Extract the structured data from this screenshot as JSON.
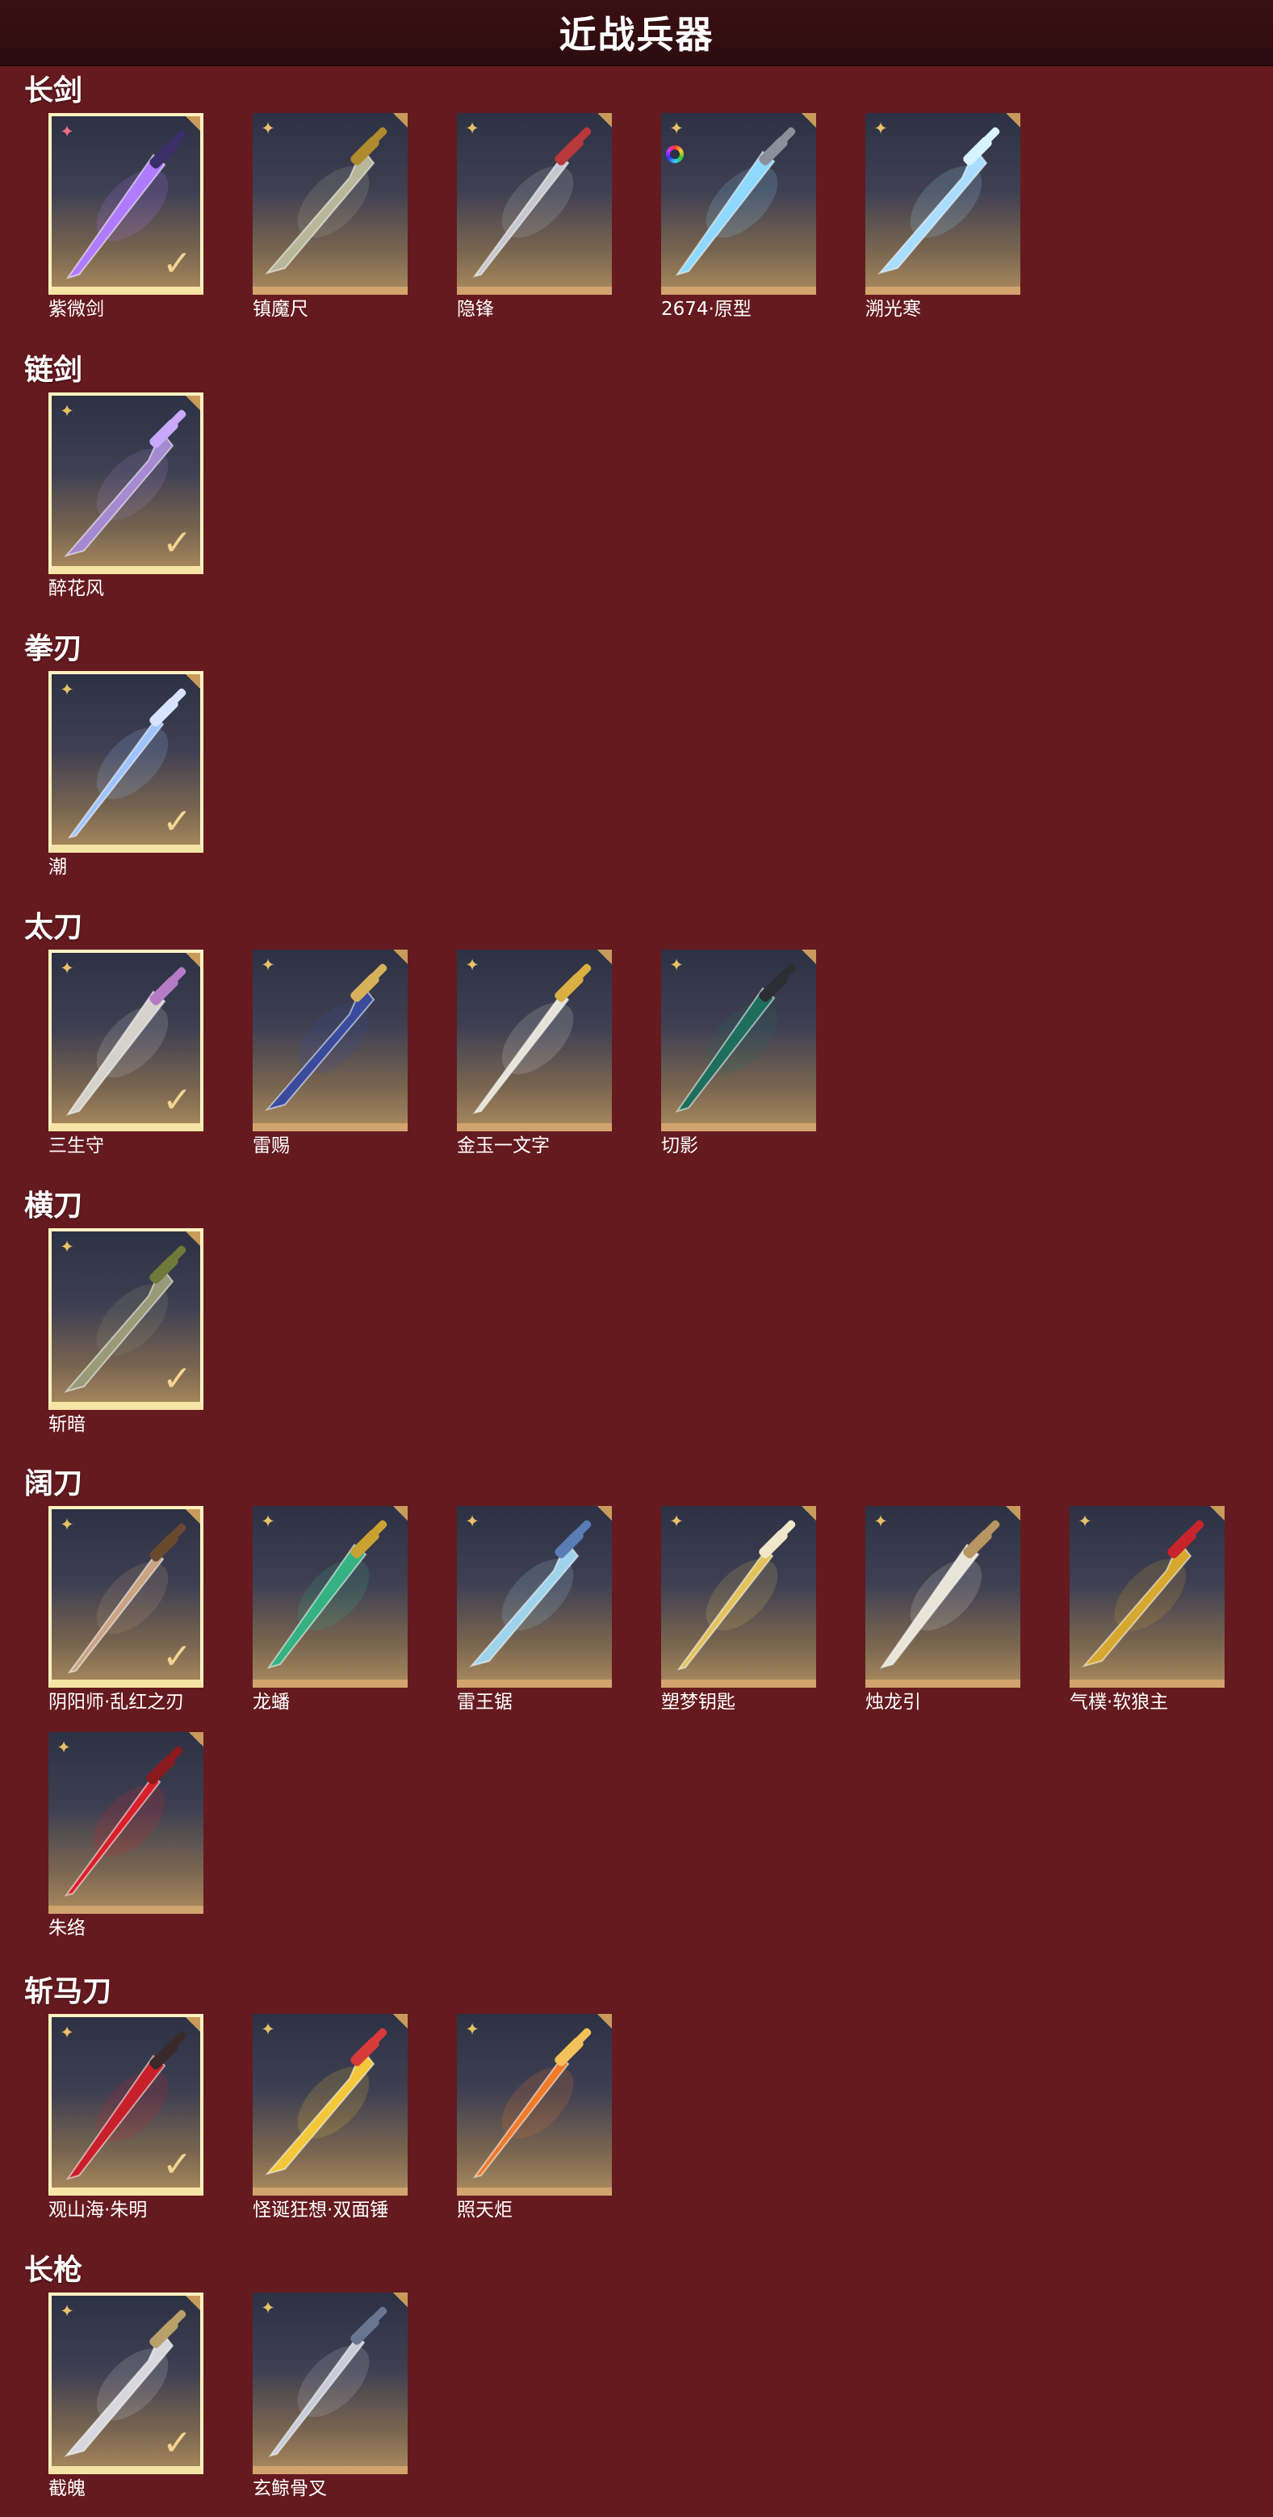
{
  "page": {
    "title": "近战兵器"
  },
  "sections": [
    {
      "title": "长剑",
      "items": [
        {
          "name": "紫微剑",
          "owned": true,
          "badge": "pink",
          "blade": "#b07cff",
          "hilt": "#3b2f6a"
        },
        {
          "name": "镇魔尺",
          "owned": false,
          "badge": "gold",
          "blade": "#b9b79a",
          "hilt": "#b08a2e"
        },
        {
          "name": "隐锋",
          "owned": false,
          "badge": "gold",
          "blade": "#c7c7cf",
          "hilt": "#b8383c"
        },
        {
          "name": "2674·原型",
          "owned": false,
          "badge": "gold",
          "rgb": true,
          "blade": "#8fd8ff",
          "hilt": "#8a8f99"
        },
        {
          "name": "溯光寒",
          "owned": false,
          "badge": "gold",
          "blade": "#a9dcff",
          "hilt": "#d9f2ff"
        }
      ]
    },
    {
      "title": "链剑",
      "items": [
        {
          "name": "醉花风",
          "owned": true,
          "badge": "gold",
          "blade": "#a58ad1",
          "hilt": "#c8a9ff"
        }
      ]
    },
    {
      "title": "拳刃",
      "items": [
        {
          "name": "潮",
          "owned": true,
          "badge": "gold",
          "blade": "#9ec3ff",
          "hilt": "#d8e4ff"
        }
      ]
    },
    {
      "title": "太刀",
      "items": [
        {
          "name": "三生守",
          "owned": true,
          "badge": "gold",
          "blade": "#d5d2cc",
          "hilt": "#b57cc6"
        },
        {
          "name": "雷赐",
          "owned": false,
          "badge": "gold",
          "blade": "#3a4b9e",
          "hilt": "#d8b25a"
        },
        {
          "name": "金玉一文字",
          "owned": false,
          "badge": "gold",
          "blade": "#e5e2d8",
          "hilt": "#d9b041"
        },
        {
          "name": "切影",
          "owned": false,
          "badge": "gold",
          "blade": "#1f6e5d",
          "hilt": "#2d2d34"
        }
      ]
    },
    {
      "title": "横刀",
      "items": [
        {
          "name": "斩暗",
          "owned": true,
          "badge": "gold",
          "blade": "#9a9a78",
          "hilt": "#6f7a3a"
        }
      ]
    },
    {
      "title": "阔刀",
      "items": [
        {
          "name": "阴阳师·乱红之刃",
          "owned": true,
          "badge": "gold",
          "blade": "#c9a382",
          "hilt": "#6a4a2f"
        },
        {
          "name": "龙蟠",
          "owned": false,
          "badge": "gold",
          "blade": "#36b184",
          "hilt": "#c9a233"
        },
        {
          "name": "雷王锯",
          "owned": false,
          "badge": "gold",
          "blade": "#9fd3ec",
          "hilt": "#5a7db5"
        },
        {
          "name": "塑梦钥匙",
          "owned": false,
          "badge": "gold",
          "blade": "#e3c25c",
          "hilt": "#f0e7c8"
        },
        {
          "name": "烛龙引",
          "owned": false,
          "badge": "gold",
          "blade": "#e9e4d8",
          "hilt": "#b89661"
        },
        {
          "name": "气樸·软狼主",
          "owned": false,
          "badge": "gold",
          "blade": "#d6a830",
          "hilt": "#c8242c"
        },
        {
          "name": "朱络",
          "owned": false,
          "badge": "gold",
          "blade": "#d8202a",
          "hilt": "#8a1a1d"
        }
      ]
    },
    {
      "title": "斩马刀",
      "items": [
        {
          "name": "观山海·朱明",
          "owned": true,
          "badge": "gold",
          "blade": "#c8202b",
          "hilt": "#3a2a2a"
        },
        {
          "name": "怪诞狂想·双面锤",
          "owned": false,
          "badge": "gold",
          "blade": "#f2c83a",
          "hilt": "#d83a3a"
        },
        {
          "name": "照天炬",
          "owned": false,
          "badge": "gold",
          "blade": "#f07a2a",
          "hilt": "#f3c05a"
        }
      ]
    },
    {
      "title": "长枪",
      "items": [
        {
          "name": "截魄",
          "owned": true,
          "badge": "gold",
          "blade": "#d7d7dd",
          "hilt": "#b9a06a"
        },
        {
          "name": "玄鲸骨叉",
          "owned": false,
          "badge": "gold",
          "blade": "#c8ccd8",
          "hilt": "#6a7590"
        }
      ]
    }
  ],
  "icons": {
    "badge": "four-point-star-icon",
    "owned": "checkmark-icon",
    "corner": "corner-fold-icon",
    "rgb": "rgb-ring-icon"
  },
  "colors": {
    "background": "#651a1f",
    "header": "#2c0c0f",
    "owned_border": "#fff1c0",
    "frame_bottom": "#d1a46e"
  }
}
